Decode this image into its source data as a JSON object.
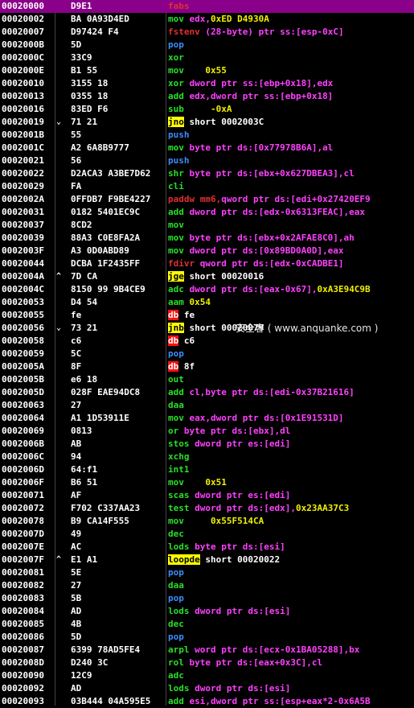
{
  "watermark": "安全客 ( www.anquanke.com )",
  "rows": [
    {
      "addr": "00020000",
      "mark": "",
      "hex": "D9E1",
      "mn": "fabs",
      "mc": "red",
      "ops": [],
      "selected": true
    },
    {
      "addr": "00020002",
      "mark": "",
      "hex": "BA 0A93D4ED",
      "mn": "mov",
      "mc": "green",
      "ops": [
        [
          "edx,",
          "magenta"
        ],
        [
          "0xED D4930A",
          "hex"
        ]
      ]
    },
    {
      "addr": "00020007",
      "mark": "",
      "hex": "D97424 F4",
      "mn": "fstenv",
      "mc": "red",
      "ops": [
        [
          "(28-byte) ptr ss:[esp-0xC]",
          "magenta"
        ]
      ]
    },
    {
      "addr": "0002000B",
      "mark": "",
      "hex": "5D",
      "mn": "pop",
      "mc": "blue",
      "ops": [
        [
          "ebp",
          "blue"
        ]
      ]
    },
    {
      "addr": "0002000C",
      "mark": "",
      "hex": "33C9",
      "mn": "xor",
      "mc": "green",
      "ops": [
        [
          "ecx,ecx",
          "green"
        ]
      ]
    },
    {
      "addr": "0002000E",
      "mark": "",
      "hex": "B1 55",
      "mn": "mov",
      "mc": "green",
      "ops": [
        [
          "cl,",
          "green"
        ],
        [
          "0x55",
          "hex"
        ]
      ]
    },
    {
      "addr": "00020010",
      "mark": "",
      "hex": "3155 18",
      "mn": "xor",
      "mc": "green",
      "ops": [
        [
          "dword ptr ss:[ebp+0x18],edx",
          "magenta"
        ]
      ]
    },
    {
      "addr": "00020013",
      "mark": "",
      "hex": "0355 18",
      "mn": "add",
      "mc": "green",
      "ops": [
        [
          "edx,dword ptr ss:[ebp+0x18]",
          "magenta"
        ]
      ]
    },
    {
      "addr": "00020016",
      "mark": "",
      "hex": "83ED F6",
      "mn": "sub",
      "mc": "green",
      "ops": [
        [
          "ebp,",
          "green"
        ],
        [
          "-0xA",
          "hex"
        ]
      ]
    },
    {
      "addr": "00020019",
      "mark": "⌄",
      "hex": "71 21",
      "mn": "jno",
      "mc": "jump",
      "ops": [
        [
          "short 0002003C",
          "white"
        ]
      ]
    },
    {
      "addr": "0002001B",
      "mark": "",
      "hex": "55",
      "mn": "push",
      "mc": "blue",
      "ops": [
        [
          "ebp",
          "blue"
        ]
      ]
    },
    {
      "addr": "0002001C",
      "mark": "",
      "hex": "A2 6A8B9777",
      "mn": "mov",
      "mc": "green",
      "ops": [
        [
          "byte ptr ds:[0x77978B6A],al",
          "magenta"
        ]
      ]
    },
    {
      "addr": "00020021",
      "mark": "",
      "hex": "56",
      "mn": "push",
      "mc": "blue",
      "ops": [
        [
          "esi",
          "blue"
        ]
      ]
    },
    {
      "addr": "00020022",
      "mark": "",
      "hex": "D2ACA3 A3BE7D62",
      "mn": "shr",
      "mc": "green",
      "ops": [
        [
          "byte ptr ds:[ebx+0x627DBEA3],cl",
          "magenta"
        ]
      ]
    },
    {
      "addr": "00020029",
      "mark": "",
      "hex": "FA",
      "mn": "cli",
      "mc": "green",
      "ops": []
    },
    {
      "addr": "0002002A",
      "mark": "",
      "hex": "0FFDB7 F9BE4227",
      "mn": "paddw",
      "mc": "red",
      "ops": [
        [
          "mm6,",
          "red"
        ],
        [
          "qword ptr ds:[edi+0x27420EF9",
          "magenta"
        ]
      ]
    },
    {
      "addr": "00020031",
      "mark": "",
      "hex": "0182 5401EC9C",
      "mn": "add",
      "mc": "green",
      "ops": [
        [
          "dword ptr ds:[edx-0x6313FEAC],eax",
          "magenta"
        ]
      ]
    },
    {
      "addr": "00020037",
      "mark": "",
      "hex": "8CD2",
      "mn": "mov",
      "mc": "green",
      "ops": [
        [
          "dx,ss",
          "green"
        ]
      ]
    },
    {
      "addr": "00020039",
      "mark": "",
      "hex": "88A3 C0E8FA2A",
      "mn": "mov",
      "mc": "green",
      "ops": [
        [
          "byte ptr ds:[ebx+0x2AFAE8C0],ah",
          "magenta"
        ]
      ]
    },
    {
      "addr": "0002003F",
      "mark": "",
      "hex": "A3 0D0ABD89",
      "mn": "mov",
      "mc": "green",
      "ops": [
        [
          "dword ptr ds:[0x89BD0A0D],eax",
          "magenta"
        ]
      ]
    },
    {
      "addr": "00020044",
      "mark": "",
      "hex": "DCBA 1F2435FF",
      "mn": "fdivr",
      "mc": "red",
      "ops": [
        [
          "qword ptr ds:[edx-0xCADBE1]",
          "magenta"
        ]
      ]
    },
    {
      "addr": "0002004A",
      "mark": "^",
      "hex": "7D CA",
      "mn": "jge",
      "mc": "jump",
      "ops": [
        [
          "short 00020016",
          "white"
        ]
      ]
    },
    {
      "addr": "0002004C",
      "mark": "",
      "hex": "8150 99 9B4CE9",
      "mn": "adc",
      "mc": "green",
      "ops": [
        [
          "dword ptr ds:[eax-0x67],",
          "magenta"
        ],
        [
          "0xA3E94C9B",
          "hex"
        ]
      ]
    },
    {
      "addr": "00020053",
      "mark": "",
      "hex": "D4 54",
      "mn": "aam",
      "mc": "green",
      "ops": [
        [
          "0x54",
          "hex"
        ]
      ]
    },
    {
      "addr": "00020055",
      "mark": "",
      "hex": "fe",
      "mn": "db",
      "mc": "db",
      "ops": [
        [
          "fe",
          "white"
        ]
      ]
    },
    {
      "addr": "00020056",
      "mark": "⌄",
      "hex": "73 21",
      "mn": "jnb",
      "mc": "jump",
      "ops": [
        [
          "short 00020079",
          "white"
        ]
      ]
    },
    {
      "addr": "00020058",
      "mark": "",
      "hex": "c6",
      "mn": "db",
      "mc": "db",
      "ops": [
        [
          "c6",
          "white"
        ]
      ]
    },
    {
      "addr": "00020059",
      "mark": "",
      "hex": "5C",
      "mn": "pop",
      "mc": "blue",
      "ops": [
        [
          "esp",
          "blue"
        ]
      ]
    },
    {
      "addr": "0002005A",
      "mark": "",
      "hex": "8F",
      "mn": "db",
      "mc": "db",
      "ops": [
        [
          "8f",
          "white"
        ]
      ]
    },
    {
      "addr": "0002005B",
      "mark": "",
      "hex": "e6 18",
      "mn": "out",
      "mc": "green",
      "ops": [
        [
          "0x18,al",
          "green"
        ]
      ]
    },
    {
      "addr": "0002005D",
      "mark": "",
      "hex": "028F EAE94DC8",
      "mn": "add",
      "mc": "green",
      "ops": [
        [
          "cl,byte ptr ds:[edi-0x37B21616]",
          "magenta"
        ]
      ]
    },
    {
      "addr": "00020063",
      "mark": "",
      "hex": "27",
      "mn": "daa",
      "mc": "green",
      "ops": []
    },
    {
      "addr": "00020064",
      "mark": "",
      "hex": "A1 1D53911E",
      "mn": "mov",
      "mc": "green",
      "ops": [
        [
          "eax,dword ptr ds:[0x1E91531D]",
          "magenta"
        ]
      ]
    },
    {
      "addr": "00020069",
      "mark": "",
      "hex": "0813",
      "mn": "or",
      "mc": "green",
      "ops": [
        [
          "byte ptr ds:[ebx],dl",
          "magenta"
        ]
      ]
    },
    {
      "addr": "0002006B",
      "mark": "",
      "hex": "AB",
      "mn": "stos",
      "mc": "green",
      "ops": [
        [
          "dword ptr es:[edi]",
          "magenta"
        ]
      ]
    },
    {
      "addr": "0002006C",
      "mark": "",
      "hex": "94",
      "mn": "xchg",
      "mc": "green",
      "ops": [
        [
          "eax,esp",
          "green"
        ]
      ]
    },
    {
      "addr": "0002006D",
      "mark": "",
      "hex": "64:f1",
      "mn": "int1",
      "mc": "green",
      "ops": []
    },
    {
      "addr": "0002006F",
      "mark": "",
      "hex": "B6 51",
      "mn": "mov",
      "mc": "green",
      "ops": [
        [
          "dh,",
          "green"
        ],
        [
          "0x51",
          "hex"
        ]
      ]
    },
    {
      "addr": "00020071",
      "mark": "",
      "hex": "AF",
      "mn": "scas",
      "mc": "green",
      "ops": [
        [
          "dword ptr es:[edi]",
          "magenta"
        ]
      ]
    },
    {
      "addr": "00020072",
      "mark": "",
      "hex": "F702 C337AA23",
      "mn": "test",
      "mc": "green",
      "ops": [
        [
          "dword ptr ds:[edx],",
          "magenta"
        ],
        [
          "0x23AA37C3",
          "hex"
        ]
      ]
    },
    {
      "addr": "00020078",
      "mark": "",
      "hex": "B9 CA14F555",
      "mn": "mov",
      "mc": "green",
      "ops": [
        [
          "ecx,",
          "green"
        ],
        [
          "0x55F514CA",
          "hex"
        ]
      ]
    },
    {
      "addr": "0002007D",
      "mark": "",
      "hex": "49",
      "mn": "dec",
      "mc": "green",
      "ops": [
        [
          "ecx",
          "green"
        ]
      ]
    },
    {
      "addr": "0002007E",
      "mark": "",
      "hex": "AC",
      "mn": "lods",
      "mc": "green",
      "ops": [
        [
          "byte ptr ds:[esi]",
          "magenta"
        ]
      ]
    },
    {
      "addr": "0002007F",
      "mark": "^",
      "hex": "E1 A1",
      "mn": "loopde",
      "mc": "loop",
      "ops": [
        [
          "short 00020022",
          "white"
        ]
      ]
    },
    {
      "addr": "00020081",
      "mark": "",
      "hex": "5E",
      "mn": "pop",
      "mc": "blue",
      "ops": [
        [
          "esi",
          "blue"
        ]
      ]
    },
    {
      "addr": "00020082",
      "mark": "",
      "hex": "27",
      "mn": "daa",
      "mc": "green",
      "ops": []
    },
    {
      "addr": "00020083",
      "mark": "",
      "hex": "5B",
      "mn": "pop",
      "mc": "blue",
      "ops": [
        [
          "ebx",
          "blue"
        ]
      ]
    },
    {
      "addr": "00020084",
      "mark": "",
      "hex": "AD",
      "mn": "lods",
      "mc": "green",
      "ops": [
        [
          "dword ptr ds:[esi]",
          "magenta"
        ]
      ]
    },
    {
      "addr": "00020085",
      "mark": "",
      "hex": "4B",
      "mn": "dec",
      "mc": "green",
      "ops": [
        [
          "ebx",
          "green"
        ]
      ]
    },
    {
      "addr": "00020086",
      "mark": "",
      "hex": "5D",
      "mn": "pop",
      "mc": "blue",
      "ops": [
        [
          "ebp",
          "blue"
        ]
      ]
    },
    {
      "addr": "00020087",
      "mark": "",
      "hex": "6399 78AD5FE4",
      "mn": "arpl",
      "mc": "green",
      "ops": [
        [
          "word ptr ds:[ecx-0x1BA05288],bx",
          "magenta"
        ]
      ]
    },
    {
      "addr": "0002008D",
      "mark": "",
      "hex": "D240 3C",
      "mn": "rol",
      "mc": "green",
      "ops": [
        [
          "byte ptr ds:[eax+0x3C],cl",
          "magenta"
        ]
      ]
    },
    {
      "addr": "00020090",
      "mark": "",
      "hex": "12C9",
      "mn": "adc",
      "mc": "green",
      "ops": [
        [
          "cl,cl",
          "green"
        ]
      ]
    },
    {
      "addr": "00020092",
      "mark": "",
      "hex": "AD",
      "mn": "lods",
      "mc": "green",
      "ops": [
        [
          "dword ptr ds:[esi]",
          "magenta"
        ]
      ]
    },
    {
      "addr": "00020093",
      "mark": "",
      "hex": "03B444 04A595E5",
      "mn": "add",
      "mc": "green",
      "ops": [
        [
          "esi,dword ptr ss:[esp+eax*2-0x6A5B",
          "magenta"
        ]
      ]
    }
  ]
}
